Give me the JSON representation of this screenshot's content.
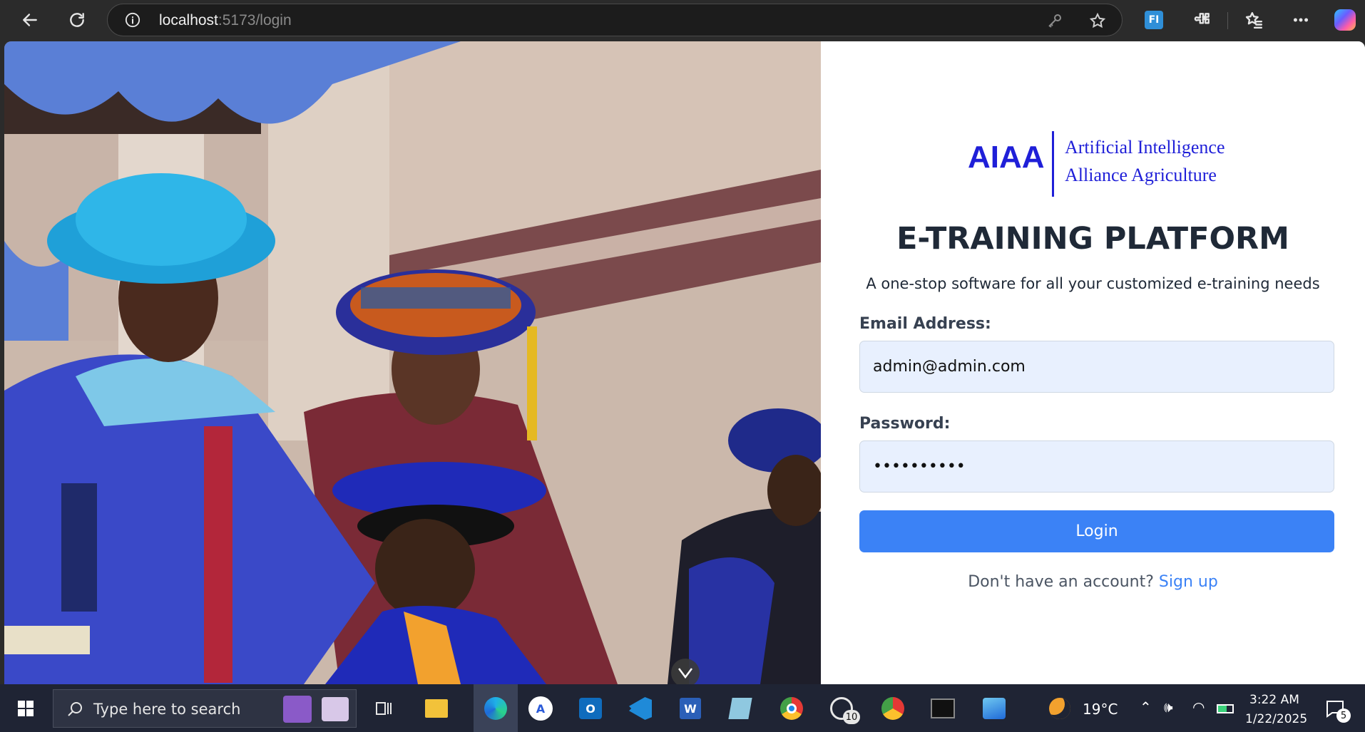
{
  "browser": {
    "url_host": "localhost",
    "url_path": ":5173/login"
  },
  "logo": {
    "abbr": "AIAA",
    "line1": "Artificial Intelligence",
    "line2": "Alliance Agriculture"
  },
  "login": {
    "title": "E-TRAINING PLATFORM",
    "subtitle": "A one-stop software for all your customized e-training needs",
    "email_label": "Email Address:",
    "email_value": "admin@admin.com",
    "password_label": "Password:",
    "password_value": "••••••••••",
    "login_button": "Login",
    "signup_prompt": "Don't have an account?",
    "signup_link": "Sign up"
  },
  "taskbar": {
    "search_placeholder": "Type here to search",
    "whatsapp_badge": "10",
    "temperature": "19°C",
    "time": "3:22 AM",
    "date": "1/22/2025",
    "notifications": "5"
  },
  "colors": {
    "brand_blue": "#1f1fd8",
    "button_blue": "#3b82f6"
  }
}
